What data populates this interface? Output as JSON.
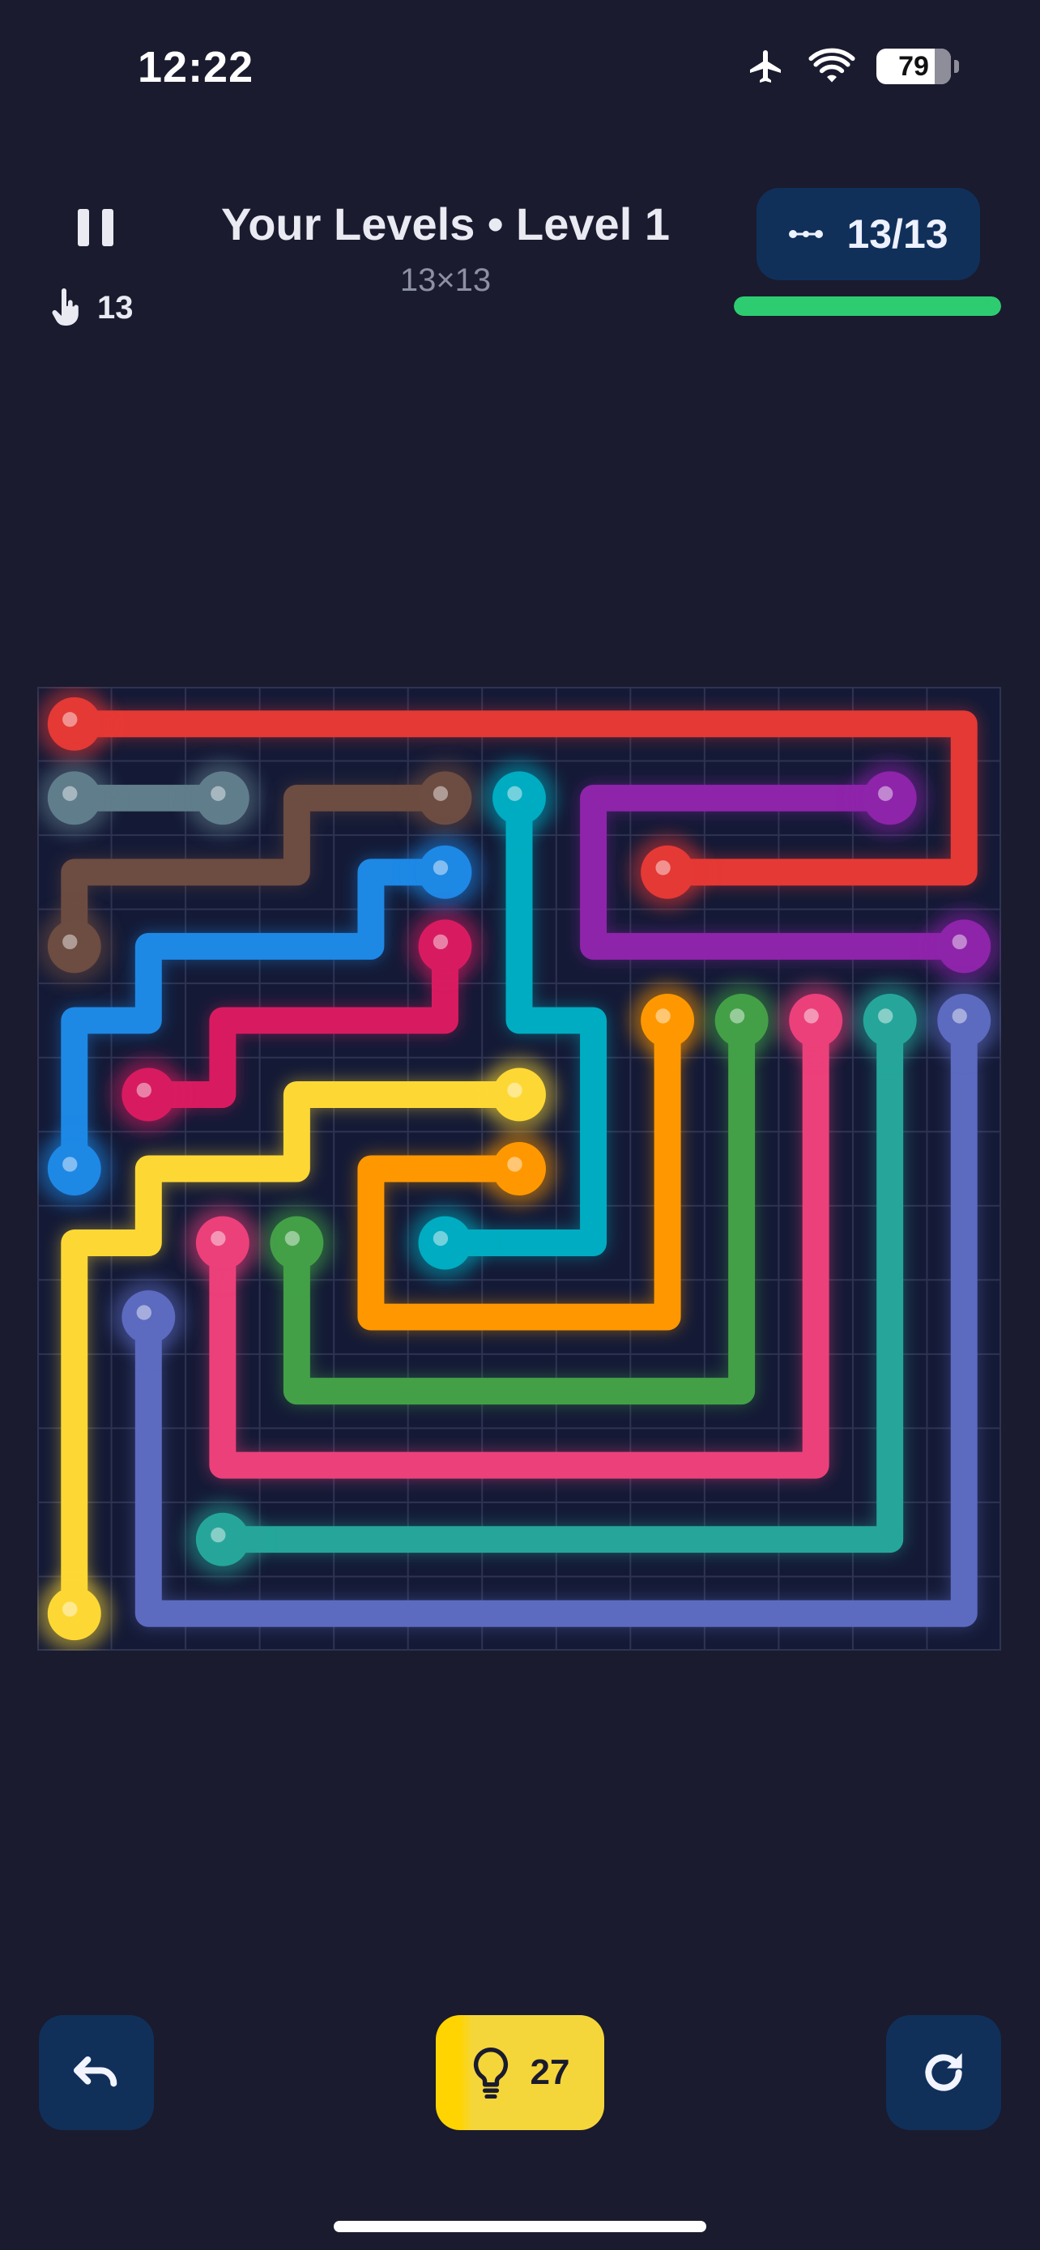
{
  "status_bar": {
    "time": "12:22",
    "battery_level": "79",
    "battery_fraction": 0.79,
    "icons": [
      "airplane-icon",
      "wifi-icon",
      "battery-icon"
    ]
  },
  "header": {
    "title": "Your Levels • Level 1",
    "subtitle": "13×13",
    "moves_count": "13",
    "flows_label": "13/13",
    "progress_fraction": 1.0,
    "icons": [
      "pause-icon",
      "tap-icon",
      "flows-icon"
    ]
  },
  "board": {
    "size": 13,
    "colors": {
      "grid_bg": "#141a36",
      "grid_line": "#2e3352",
      "red": "#e53935",
      "slate": "#607d8b",
      "brown": "#6d4c41",
      "cyan": "#00acc1",
      "purple": "#8e24aa",
      "blue": "#1e88e5",
      "crimson": "#d81b60",
      "yellow": "#fdd835",
      "orange": "#ff9800",
      "green": "#43a047",
      "pink": "#ec407a",
      "teal": "#26a69a",
      "indigo": "#5c6bc0"
    },
    "flows": [
      {
        "color": "red",
        "path": [
          [
            0,
            0
          ],
          [
            0,
            12
          ],
          [
            2,
            12
          ],
          [
            2,
            8
          ]
        ]
      },
      {
        "color": "slate",
        "path": [
          [
            1,
            0
          ],
          [
            1,
            2
          ]
        ]
      },
      {
        "color": "brown",
        "path": [
          [
            3,
            0
          ],
          [
            2,
            0
          ],
          [
            2,
            3
          ],
          [
            1,
            3
          ],
          [
            1,
            5
          ]
        ]
      },
      {
        "color": "cyan",
        "path": [
          [
            1,
            6
          ],
          [
            4,
            6
          ],
          [
            4,
            7
          ],
          [
            7,
            7
          ],
          [
            7,
            5
          ]
        ]
      },
      {
        "color": "purple",
        "path": [
          [
            1,
            11
          ],
          [
            1,
            7
          ],
          [
            3,
            7
          ],
          [
            3,
            12
          ]
        ]
      },
      {
        "color": "blue",
        "path": [
          [
            6,
            0
          ],
          [
            4,
            0
          ],
          [
            4,
            1
          ],
          [
            3,
            1
          ],
          [
            3,
            4
          ],
          [
            2,
            4
          ],
          [
            2,
            5
          ]
        ]
      },
      {
        "color": "crimson",
        "path": [
          [
            3,
            5
          ],
          [
            4,
            5
          ],
          [
            4,
            2
          ],
          [
            5,
            2
          ],
          [
            5,
            1
          ]
        ]
      },
      {
        "color": "yellow",
        "path": [
          [
            12,
            0
          ],
          [
            7,
            0
          ],
          [
            7,
            1
          ],
          [
            6,
            1
          ],
          [
            6,
            3
          ],
          [
            5,
            3
          ],
          [
            5,
            6
          ]
        ]
      },
      {
        "color": "orange",
        "path": [
          [
            6,
            6
          ],
          [
            6,
            4
          ],
          [
            8,
            4
          ],
          [
            8,
            8
          ],
          [
            4,
            8
          ]
        ]
      },
      {
        "color": "green",
        "path": [
          [
            7,
            3
          ],
          [
            9,
            3
          ],
          [
            9,
            9
          ],
          [
            4,
            9
          ]
        ]
      },
      {
        "color": "pink",
        "path": [
          [
            7,
            2
          ],
          [
            10,
            2
          ],
          [
            10,
            10
          ],
          [
            4,
            10
          ]
        ]
      },
      {
        "color": "teal",
        "path": [
          [
            11,
            2
          ],
          [
            11,
            11
          ],
          [
            4,
            11
          ]
        ]
      },
      {
        "color": "indigo",
        "path": [
          [
            8,
            1
          ],
          [
            12,
            1
          ],
          [
            12,
            12
          ],
          [
            4,
            12
          ]
        ]
      }
    ]
  },
  "controls": {
    "hint_count": "27",
    "icons": [
      "undo-icon",
      "lightbulb-icon",
      "restart-icon"
    ]
  }
}
